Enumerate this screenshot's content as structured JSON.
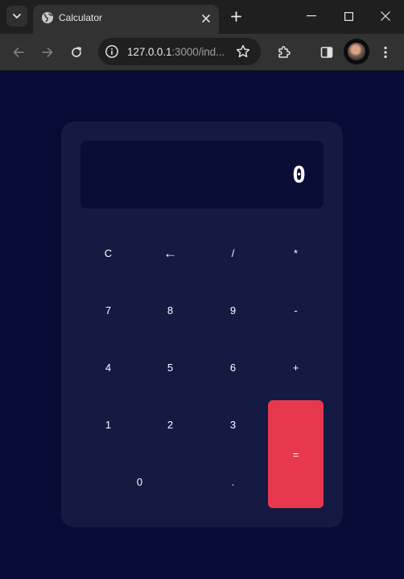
{
  "browser": {
    "tab_title": "Calculator",
    "url_host": "127.0.0.1",
    "url_rest": ":3000/ind..."
  },
  "calculator": {
    "display": "0",
    "keys": {
      "clear": "C",
      "backspace": "←",
      "divide": "/",
      "multiply": "*",
      "seven": "7",
      "eight": "8",
      "nine": "9",
      "minus": "-",
      "four": "4",
      "five": "5",
      "six": "6",
      "plus": "+",
      "one": "1",
      "two": "2",
      "three": "3",
      "equals": "=",
      "zero": "0",
      "decimal": "."
    }
  },
  "colors": {
    "page_background": "#070b35",
    "calculator_panel": "#141a42",
    "display_background": "#0a0e36",
    "equals_button": "#e8384e"
  },
  "icons": [
    "tab-search-icon",
    "globe-icon",
    "close-icon",
    "plus-icon",
    "minimize-icon",
    "maximize-icon",
    "close-window-icon",
    "back-arrow-icon",
    "forward-arrow-icon",
    "reload-icon",
    "info-icon",
    "star-icon",
    "extensions-icon",
    "side-panel-icon",
    "profile-avatar",
    "more-menu-icon"
  ]
}
